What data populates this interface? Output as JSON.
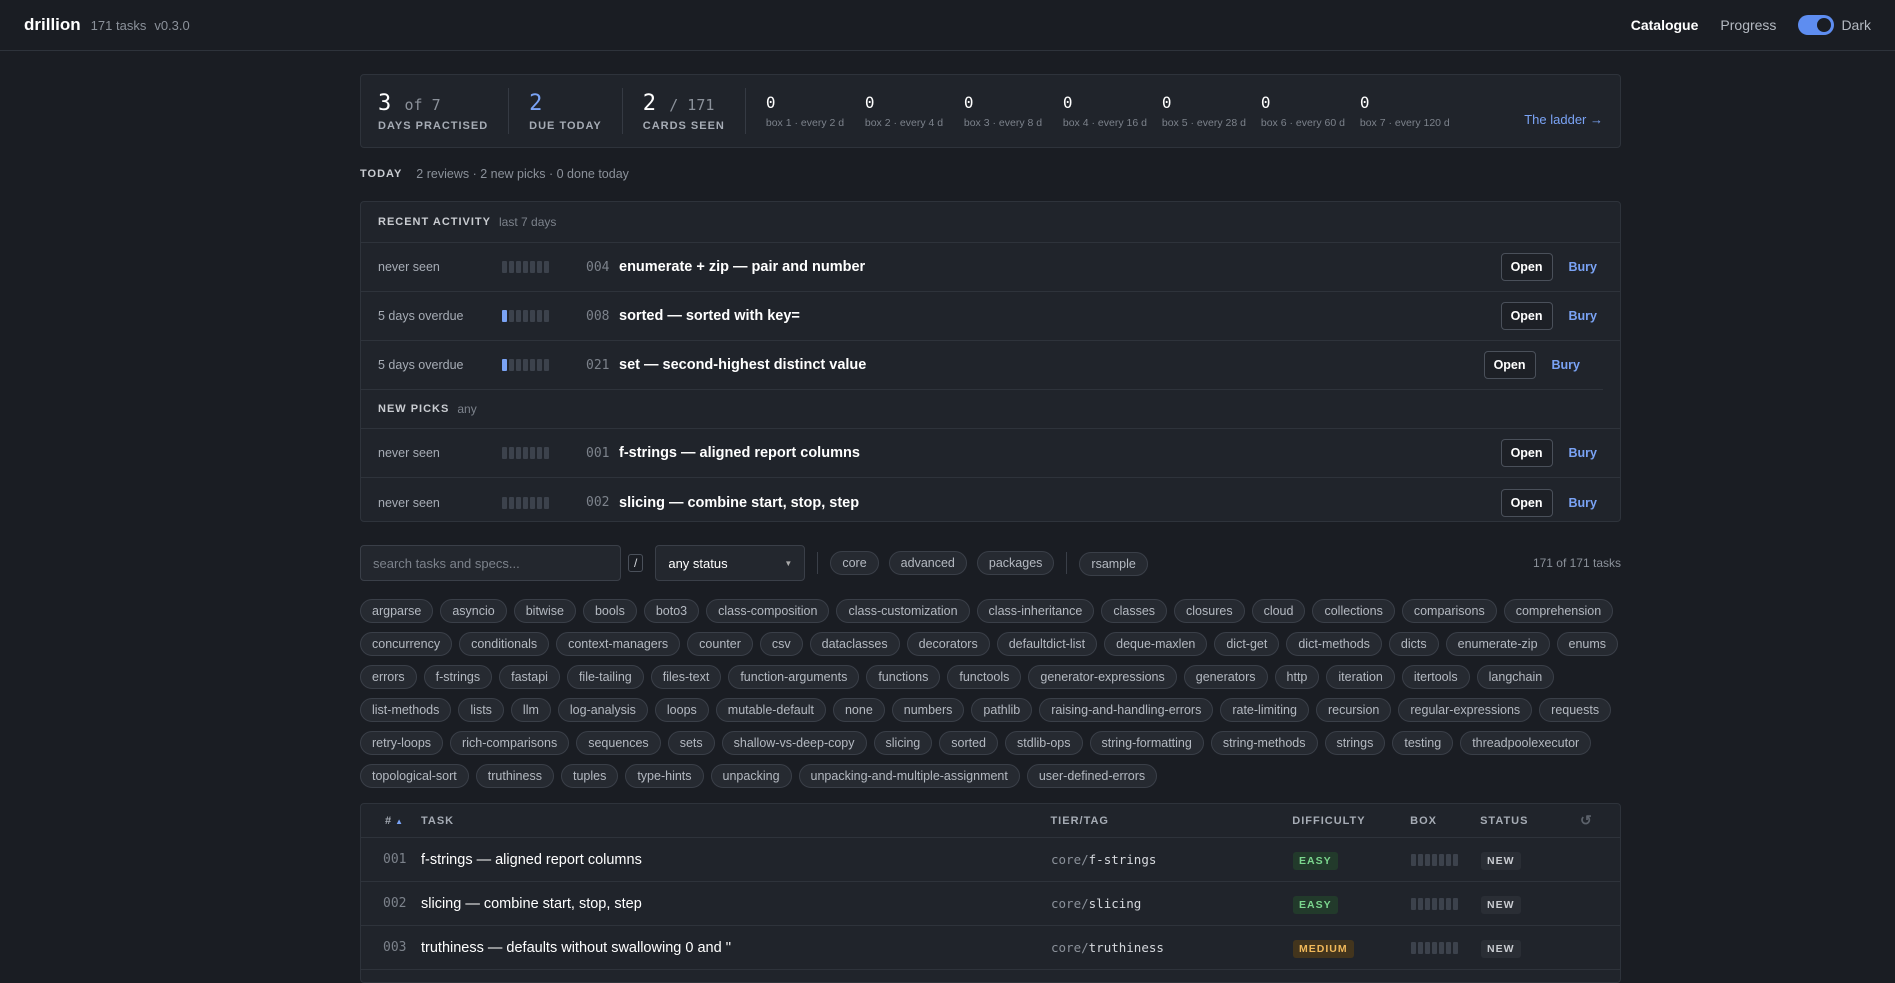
{
  "app": {
    "name": "drillion",
    "task_count": "171 tasks",
    "version": "v0.3.0"
  },
  "nav": {
    "catalogue": "Catalogue",
    "progress": "Progress",
    "theme_label": "Dark",
    "theme_dark": true
  },
  "stats": {
    "days_practised": {
      "value": "3",
      "of": "of 7",
      "label": "DAYS PRACTISED"
    },
    "due_today": {
      "value": "2",
      "label": "DUE TODAY"
    },
    "cards_seen": {
      "value": "2",
      "of": "/ 171",
      "label": "CARDS SEEN"
    },
    "boxes": [
      {
        "count": "0",
        "desc": "box 1 · every 2 d"
      },
      {
        "count": "0",
        "desc": "box 2 · every 4 d"
      },
      {
        "count": "0",
        "desc": "box 3 · every 8 d"
      },
      {
        "count": "0",
        "desc": "box 4 · every 16 d"
      },
      {
        "count": "0",
        "desc": "box 5 · every 28 d"
      },
      {
        "count": "0",
        "desc": "box 6 · every 60 d"
      },
      {
        "count": "0",
        "desc": "box 7 · every 120 d"
      }
    ],
    "ladder_link": "The ladder →"
  },
  "today": {
    "title": "TODAY",
    "summary": "2 reviews · 2 new picks · 0 done today"
  },
  "recent": {
    "title": "RECENT ACTIVITY",
    "subtitle": "last 7 days",
    "rows": [
      {
        "status": "never seen",
        "level": 0,
        "id": "004",
        "title": "enumerate + zip — pair and number"
      },
      {
        "status": "5 days overdue",
        "level": 1,
        "id": "008",
        "title": "sorted — sorted with key="
      },
      {
        "status": "5 days overdue",
        "level": 1,
        "id": "021",
        "title": "set — second-highest distinct value"
      }
    ]
  },
  "new_picks": {
    "title": "NEW PICKS",
    "subtitle": "any",
    "rows": [
      {
        "status": "never seen",
        "level": 0,
        "id": "001",
        "title": "f-strings — aligned report columns"
      },
      {
        "status": "never seen",
        "level": 0,
        "id": "002",
        "title": "slicing — combine start, stop, step"
      }
    ]
  },
  "actions": {
    "open": "Open",
    "bury": "Bury"
  },
  "filters": {
    "search_placeholder": "search tasks and specs...",
    "shortcut": "/",
    "status_value": "any status",
    "tiers": [
      "core",
      "advanced",
      "packages",
      "rsample"
    ],
    "count": "171 of 171 tasks"
  },
  "tags": [
    "argparse",
    "asyncio",
    "bitwise",
    "bools",
    "boto3",
    "class-composition",
    "class-customization",
    "class-inheritance",
    "classes",
    "closures",
    "cloud",
    "collections",
    "comparisons",
    "comprehension",
    "concurrency",
    "conditionals",
    "context-managers",
    "counter",
    "csv",
    "dataclasses",
    "decorators",
    "defaultdict-list",
    "deque-maxlen",
    "dict-get",
    "dict-methods",
    "dicts",
    "enumerate-zip",
    "enums",
    "errors",
    "f-strings",
    "fastapi",
    "file-tailing",
    "files-text",
    "function-arguments",
    "functions",
    "functools",
    "generator-expressions",
    "generators",
    "http",
    "iteration",
    "itertools",
    "langchain",
    "list-methods",
    "lists",
    "llm",
    "log-analysis",
    "loops",
    "mutable-default",
    "none",
    "numbers",
    "pathlib",
    "raising-and-handling-errors",
    "rate-limiting",
    "recursion",
    "regular-expressions",
    "requests",
    "retry-loops",
    "rich-comparisons",
    "sequences",
    "sets",
    "shallow-vs-deep-copy",
    "slicing",
    "sorted",
    "stdlib-ops",
    "string-formatting",
    "string-methods",
    "strings",
    "testing",
    "threadpoolexecutor",
    "topological-sort",
    "truthiness",
    "tuples",
    "type-hints",
    "unpacking",
    "unpacking-and-multiple-assignment",
    "user-defined-errors"
  ],
  "table": {
    "headers": {
      "num": "#",
      "task": "TASK",
      "tier": "TIER/TAG",
      "difficulty": "DIFFICULTY",
      "box": "BOX",
      "status": "STATUS"
    },
    "rows": [
      {
        "id": "001",
        "task": "f-strings — aligned report columns",
        "tier": "core/",
        "tag": "f-strings",
        "difficulty": "EASY",
        "level": "easy",
        "status": "NEW"
      },
      {
        "id": "002",
        "task": "slicing — combine start, stop, step",
        "tier": "core/",
        "tag": "slicing",
        "difficulty": "EASY",
        "level": "easy",
        "status": "NEW"
      },
      {
        "id": "003",
        "task": "truthiness — defaults without swallowing 0 and ''",
        "tier": "core/",
        "tag": "truthiness",
        "difficulty": "MEDIUM",
        "level": "medium",
        "status": "NEW"
      }
    ]
  },
  "colors": {
    "accent": "#7aa3f5",
    "background": "#1a1d23",
    "panel": "#20242b"
  }
}
